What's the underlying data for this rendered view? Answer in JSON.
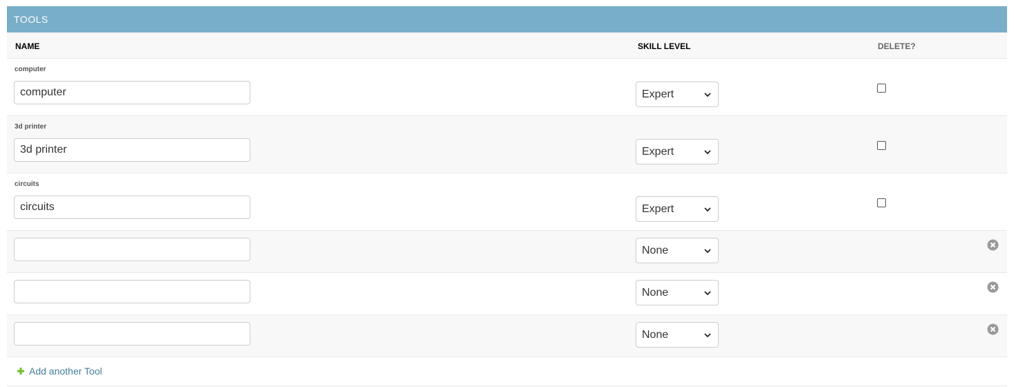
{
  "group": {
    "title": "TOOLS",
    "columns": {
      "name": "NAME",
      "skill_level": "SKILL LEVEL",
      "delete": "DELETE?"
    }
  },
  "existing_rows": [
    {
      "label": "computer",
      "name_value": "computer",
      "skill_level": "Expert",
      "delete_checked": false
    },
    {
      "label": "3d printer",
      "name_value": "3d printer",
      "skill_level": "Expert",
      "delete_checked": false
    },
    {
      "label": "circuits",
      "name_value": "circuits",
      "skill_level": "Expert",
      "delete_checked": false
    }
  ],
  "extra_rows": [
    {
      "name_value": "",
      "skill_level": "None"
    },
    {
      "name_value": "",
      "skill_level": "None"
    },
    {
      "name_value": "",
      "skill_level": "None"
    }
  ],
  "add_link": {
    "label": "Add another Tool",
    "icon": "plus-icon"
  },
  "colors": {
    "header_bg": "#79aec8",
    "link": "#447e9b",
    "add_icon": "#70bf2b",
    "remove_icon": "#999999"
  }
}
